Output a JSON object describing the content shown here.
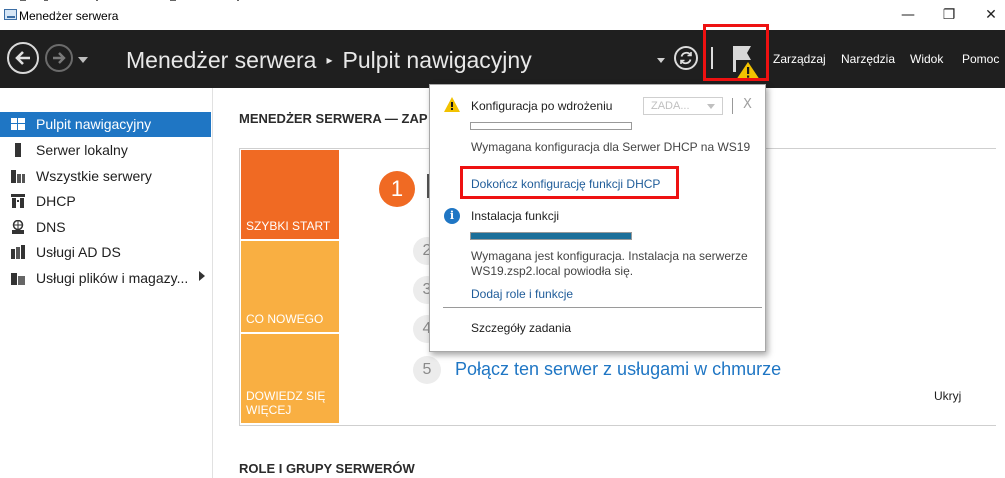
{
  "window": {
    "title": "Menedżer serwera",
    "controls": {
      "minimize": "—",
      "maximize": "❐",
      "close": "✕"
    }
  },
  "header": {
    "breadcrumb_app": "Menedżer serwera",
    "breadcrumb_separator": "▸",
    "breadcrumb_page": "Pulpit nawigacyjny",
    "menu": [
      "Zarządzaj",
      "Narzędzia",
      "Widok",
      "Pomoc"
    ],
    "icons": {
      "back": "back-arrow-icon",
      "forward": "forward-arrow-icon",
      "refresh": "refresh-icon",
      "notifications": "flag-warning-icon"
    },
    "accent_color": "#1f1f1f"
  },
  "sidebar": {
    "items": [
      {
        "label": "Pulpit nawigacyjny",
        "icon": "dashboard-icon",
        "active": true
      },
      {
        "label": "Serwer lokalny",
        "icon": "server-icon"
      },
      {
        "label": "Wszystkie serwery",
        "icon": "servers-icon"
      },
      {
        "label": "DHCP",
        "icon": "dhcp-icon"
      },
      {
        "label": "DNS",
        "icon": "dns-icon"
      },
      {
        "label": "Usługi AD DS",
        "icon": "ad-ds-icon"
      },
      {
        "label": "Usługi plików i magazy...",
        "icon": "file-services-icon",
        "has_submenu": true
      }
    ],
    "active_color": "#1f76c4"
  },
  "main": {
    "welcome_title": "MENEDŻER SERWERA — ZAP",
    "tiles": [
      "SZYBKI START",
      "CO NOWEGO",
      "DOWIEDZ SIĘ WIĘCEJ"
    ],
    "tile_colors": {
      "active": "#f06a23",
      "inactive": "#f9af42"
    },
    "steps": [
      {
        "number": "1"
      },
      {
        "number": "2"
      },
      {
        "number": "3"
      },
      {
        "number": "4"
      },
      {
        "number": "5",
        "text": "Połącz ten serwer z usługami w chmurze"
      }
    ],
    "hide_label": "Ukryj",
    "roles_title": "ROLE I GRUPY SERWERÓW"
  },
  "notifications": {
    "task1": {
      "title": "Konfiguracja po wdrożeniu",
      "dropdown_label": "ZADA...",
      "close": "X",
      "progress": 0,
      "message": "Wymagana konfiguracja dla Serwer DHCP na WS19",
      "link": "Dokończ konfigurację funkcji DHCP"
    },
    "task2": {
      "title": "Instalacja funkcji",
      "progress": 1,
      "message_line1": "Wymagana jest konfiguracja. Instalacja na serwerze",
      "message_line2": "WS19.zsp2.local powiodła się.",
      "link": "Dodaj role i funkcje"
    },
    "details_link": "Szczegóły zadania"
  }
}
